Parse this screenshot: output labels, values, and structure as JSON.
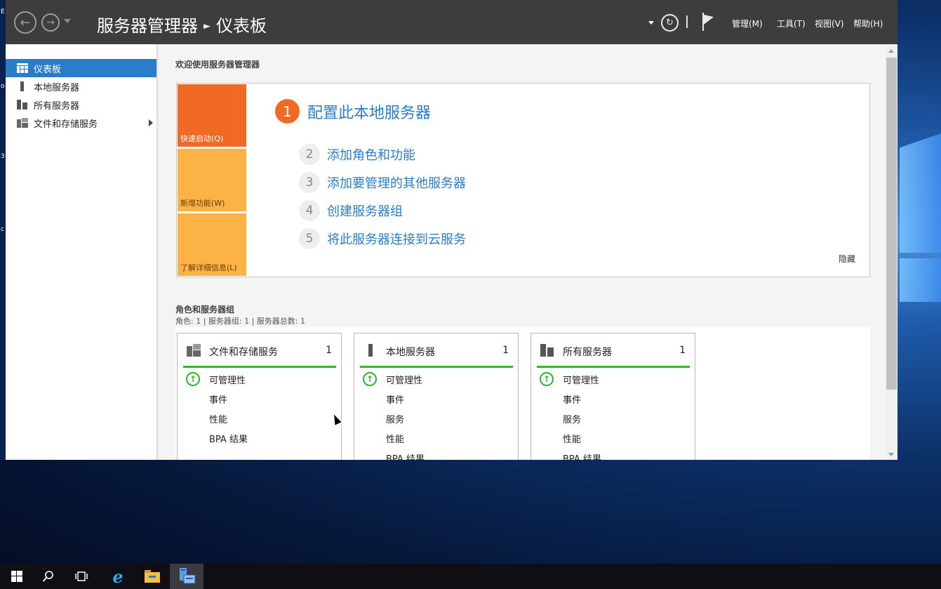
{
  "window": {
    "breadcrumb_root": "服务器管理器",
    "breadcrumb_page": "仪表板",
    "menus": [
      "管理(M)",
      "工具(T)",
      "视图(V)",
      "帮助(H)"
    ]
  },
  "sidebar": {
    "items": [
      {
        "label": "仪表板",
        "icon": "dashboard-icon",
        "active": true
      },
      {
        "label": "本地服务器",
        "icon": "server-icon"
      },
      {
        "label": "所有服务器",
        "icon": "servers-icon"
      },
      {
        "label": "文件和存储服务",
        "icon": "file-storage-icon",
        "has_children": true
      }
    ]
  },
  "main": {
    "welcome": "欢迎使用服务器管理器",
    "quickstart": {
      "tiles": [
        "快速启动(Q)",
        "新增功能(W)",
        "了解详细信息(L)"
      ],
      "step1": {
        "num": "1",
        "label": "配置此本地服务器"
      },
      "steps": [
        {
          "num": "2",
          "label": "添加角色和功能"
        },
        {
          "num": "3",
          "label": "添加要管理的其他服务器"
        },
        {
          "num": "4",
          "label": "创建服务器组"
        },
        {
          "num": "5",
          "label": "将此服务器连接到云服务"
        }
      ],
      "hide": "隐藏"
    },
    "roles": {
      "title": "角色和服务器组",
      "subtitle": "角色: 1 | 服务器组: 1 | 服务器总数: 1",
      "cards": [
        {
          "title": "文件和存储服务",
          "count": "1",
          "rows": [
            "可管理性",
            "事件",
            "性能",
            "BPA 结果"
          ]
        },
        {
          "title": "本地服务器",
          "count": "1",
          "rows": [
            "可管理性",
            "事件",
            "服务",
            "性能",
            "BPA 结果"
          ]
        },
        {
          "title": "所有服务器",
          "count": "1",
          "rows": [
            "可管理性",
            "事件",
            "服务",
            "性能",
            "BPA 结果"
          ]
        }
      ]
    }
  },
  "colors": {
    "accent": "#2a7dc8",
    "orange": "#f06a25",
    "amber": "#fdb245",
    "green": "#2ab92a",
    "titlebar": "#3d3d3d"
  },
  "taskbar": {
    "icons": [
      "start-icon",
      "search-icon",
      "task-view-icon",
      "internet-explorer-icon",
      "file-explorer-icon",
      "server-manager-icon"
    ]
  }
}
